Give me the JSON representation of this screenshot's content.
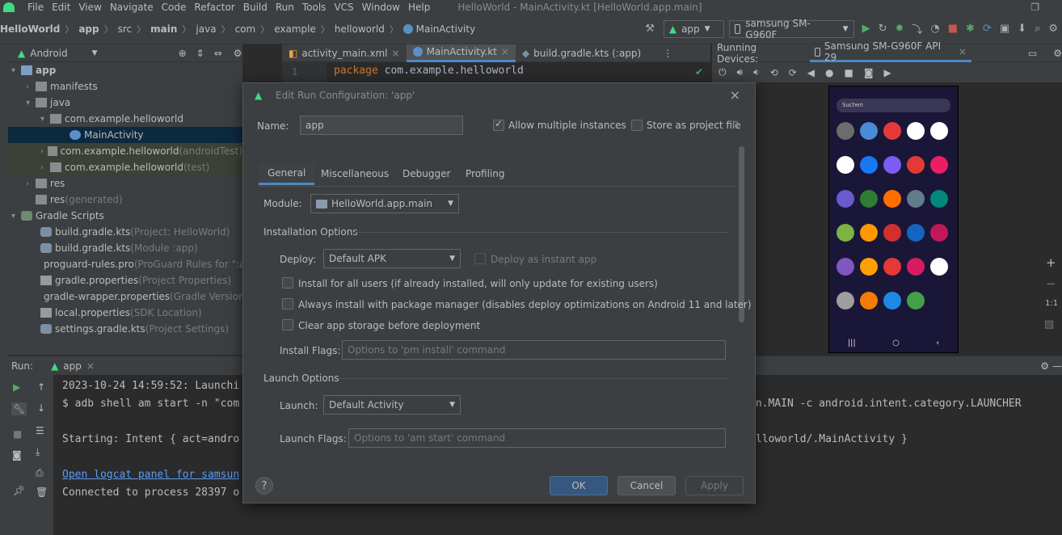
{
  "menubar": {
    "items": [
      "File",
      "Edit",
      "View",
      "Navigate",
      "Code",
      "Refactor",
      "Build",
      "Run",
      "Tools",
      "VCS",
      "Window",
      "Help"
    ],
    "window_title": "HelloWorld - MainActivity.kt [HelloWorld.app.main]"
  },
  "breadcrumb": [
    "HelloWorld",
    "app",
    "src",
    "main",
    "java",
    "com",
    "example",
    "helloworld",
    "MainActivity"
  ],
  "toolbar": {
    "run_config": "app",
    "device": "samsung SM-G960F"
  },
  "project": {
    "view": "Android",
    "tree": [
      {
        "label": "app",
        "extra": ""
      },
      {
        "label": "manifests",
        "extra": ""
      },
      {
        "label": "java",
        "extra": ""
      },
      {
        "label": "com.example.helloworld",
        "extra": ""
      },
      {
        "label": "MainActivity",
        "extra": ""
      },
      {
        "label": "com.example.helloworld",
        "extra": " (androidTest)"
      },
      {
        "label": "com.example.helloworld",
        "extra": " (test)"
      },
      {
        "label": "res",
        "extra": ""
      },
      {
        "label": "res",
        "extra": " (generated)"
      },
      {
        "label": "Gradle Scripts",
        "extra": ""
      },
      {
        "label": "build.gradle.kts",
        "extra": " (Project: HelloWorld)"
      },
      {
        "label": "build.gradle.kts",
        "extra": " (Module :app)"
      },
      {
        "label": "proguard-rules.pro",
        "extra": " (ProGuard Rules for \":ap"
      },
      {
        "label": "gradle.properties",
        "extra": " (Project Properties)"
      },
      {
        "label": "gradle-wrapper.properties",
        "extra": " (Gradle Version)"
      },
      {
        "label": "local.properties",
        "extra": " (SDK Location)"
      },
      {
        "label": "settings.gradle.kts",
        "extra": " (Project Settings)"
      }
    ]
  },
  "editor": {
    "tabs": [
      "activity_main.xml",
      "MainActivity.kt",
      "build.gradle.kts (:app)"
    ],
    "line_no": "1",
    "keyword": "package",
    "code": " com.example.helloworld"
  },
  "devices": {
    "label": "Running Devices:",
    "tab": "Samsung SM-G960F API 29",
    "search": "Suchen",
    "zoom": "1:1"
  },
  "run": {
    "label": "Run:",
    "config": "app",
    "lines": [
      "2023-10-24 14:59:52: Launchi",
      "$ adb shell am start -n \"com",
      "on.MAIN -c android.intent.category.LAUNCHER",
      "Starting: Intent { act=andro",
      "lloworld/.MainActivity }",
      "Open logcat panel for samsun",
      "Connected to process 28397 o"
    ]
  },
  "dialog": {
    "title": "Edit Run Configuration: 'app'",
    "name_label": "Name:",
    "name_value": "app",
    "allow_multiple": "Allow multiple instances",
    "store_project": "Store as project file",
    "tabs": [
      "General",
      "Miscellaneous",
      "Debugger",
      "Profiling"
    ],
    "module_label": "Module:",
    "module_value": "HelloWorld.app.main",
    "install_section": "Installation Options",
    "deploy_label": "Deploy:",
    "deploy_value": "Default APK",
    "instant_app": "Deploy as instant app",
    "opt1": "Install for all users (if already installed, will only update for existing users)",
    "opt2": "Always install with package manager (disables deploy optimizations on Android 11 and later)",
    "opt3": "Clear app storage before deployment",
    "install_flags_label": "Install Flags:",
    "install_flags_ph": "Options to 'pm install' command",
    "launch_section": "Launch Options",
    "launch_label": "Launch:",
    "launch_value": "Default Activity",
    "launch_flags_label": "Launch Flags:",
    "launch_flags_ph": "Options to 'am start' command",
    "ok": "OK",
    "cancel": "Cancel",
    "apply": "Apply",
    "help": "?"
  },
  "colors": {
    "accent": "#4a88c7",
    "primary_button": "#365880",
    "android_green": "#3ddc84"
  }
}
